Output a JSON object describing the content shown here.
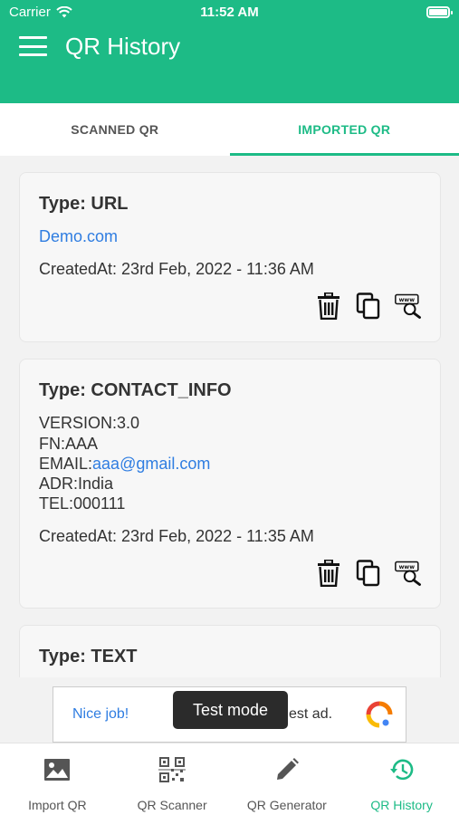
{
  "status_bar": {
    "carrier": "Carrier",
    "time": "11:52 AM"
  },
  "app_bar": {
    "title": "QR History"
  },
  "tabs": [
    {
      "label": "SCANNED QR",
      "active": false
    },
    {
      "label": "IMPORTED QR",
      "active": true
    }
  ],
  "cards": [
    {
      "type": "Type: URL",
      "link": "Demo.com",
      "created": "CreatedAt: 23rd Feb, 2022 - 11:36 AM"
    },
    {
      "type": "Type: CONTACT_INFO",
      "version": "VERSION:3.0",
      "fn": "FN:AAA",
      "email_prefix": "EMAIL:",
      "email": "aaa@gmail.com",
      "adr": "ADR:India",
      "tel": "TEL:000111",
      "created": "CreatedAt: 23rd Feb, 2022 - 11:35 AM"
    },
    {
      "type": "Type: TEXT"
    }
  ],
  "icons": {
    "delete": "trash-icon",
    "copy": "copy-icon",
    "web_search": "web-search-icon"
  },
  "ad": {
    "nice": "Nice job!",
    "tail": "est ad.",
    "toast": "Test mode"
  },
  "bottom_nav": [
    {
      "label": "Import QR",
      "icon": "image-icon"
    },
    {
      "label": "QR Scanner",
      "icon": "qr-code-icon"
    },
    {
      "label": "QR Generator",
      "icon": "pencil-icon"
    },
    {
      "label": "QR History",
      "icon": "history-icon",
      "active": true
    }
  ],
  "colors": {
    "primary": "#1dbb86",
    "link": "#2f7de1"
  }
}
